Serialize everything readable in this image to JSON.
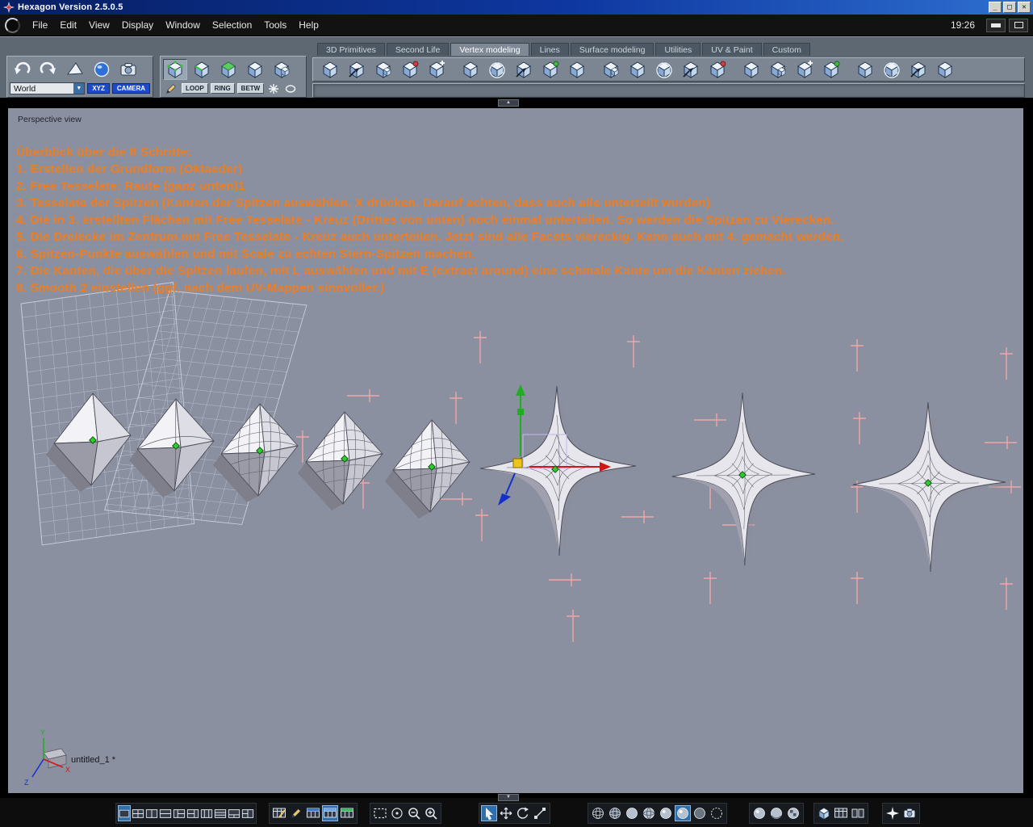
{
  "window": {
    "title": "Hexagon Version 2.5.0.5",
    "time": "19:26"
  },
  "menu": {
    "items": [
      "File",
      "Edit",
      "View",
      "Display",
      "Window",
      "Selection",
      "Tools",
      "Help"
    ]
  },
  "tabs": {
    "items": [
      {
        "label": "3D Primitives",
        "active": false
      },
      {
        "label": "Second Life",
        "active": false
      },
      {
        "label": "Vertex modeling",
        "active": true
      },
      {
        "label": "Lines",
        "active": false
      },
      {
        "label": "Surface modeling",
        "active": false
      },
      {
        "label": "Utilities",
        "active": false
      },
      {
        "label": "UV & Paint",
        "active": false
      },
      {
        "label": "Custom",
        "active": false
      }
    ]
  },
  "controls": {
    "world_select": "World",
    "xyz": "XYZ",
    "camera": "CAMERA",
    "loop": "LOOP",
    "ring": "RING",
    "betw": "BETW"
  },
  "viewport": {
    "label": "Perspective view",
    "document": "untitled_1 *",
    "axis_labels": {
      "x": "X",
      "y": "Y",
      "z": "Z"
    },
    "tutorial": {
      "title": "Überblick über die 8 Schritte:",
      "steps": [
        "1. Erstellen der Grundform (Oktaeder)",
        "2. Free Tesselate: Raute (ganz unten)1",
        "3. Tesselate der Spitzen (Kanten der Spitzen auswählen, X drücken. Darauf achten, dass auch alle unterteilt wurden)",
        "4. Die in 3. erstellten Flächen mit Free Tesselate - Kreuz (Drittes von unten) noch einmal unterteilen. So werden die Spitzen zu Vierecken.",
        "5. Die Dreiecke im Zentrum mit Free Tesselate - Kreuz auch unterteilen. Jetzt sind alle Facets viereckig. Kann auch mit 4. gemacht werden.",
        "6. Spitzen-Punkte auswählen und mit Scale zu echten Stern-Spitzen machen.",
        "7. Die Kanten, die über die Spitzen laufen, mit L auswählen und mit E (extract around) eine schmale Kante um die Kanten ziehen.",
        "8. Smooth 2 einstellen (ggf. nach dem UV-Mappen sinnvoller.)"
      ]
    }
  },
  "colors": {
    "tutorial_text": "#f07d1e",
    "viewport_background": "#8b90a1",
    "selection_green": "#2ecc2e",
    "gizmo_red": "#d41414",
    "gizmo_green": "#1fae1f",
    "gizmo_blue": "#1430cc",
    "snap_mark_pink": "#efa6a6"
  }
}
